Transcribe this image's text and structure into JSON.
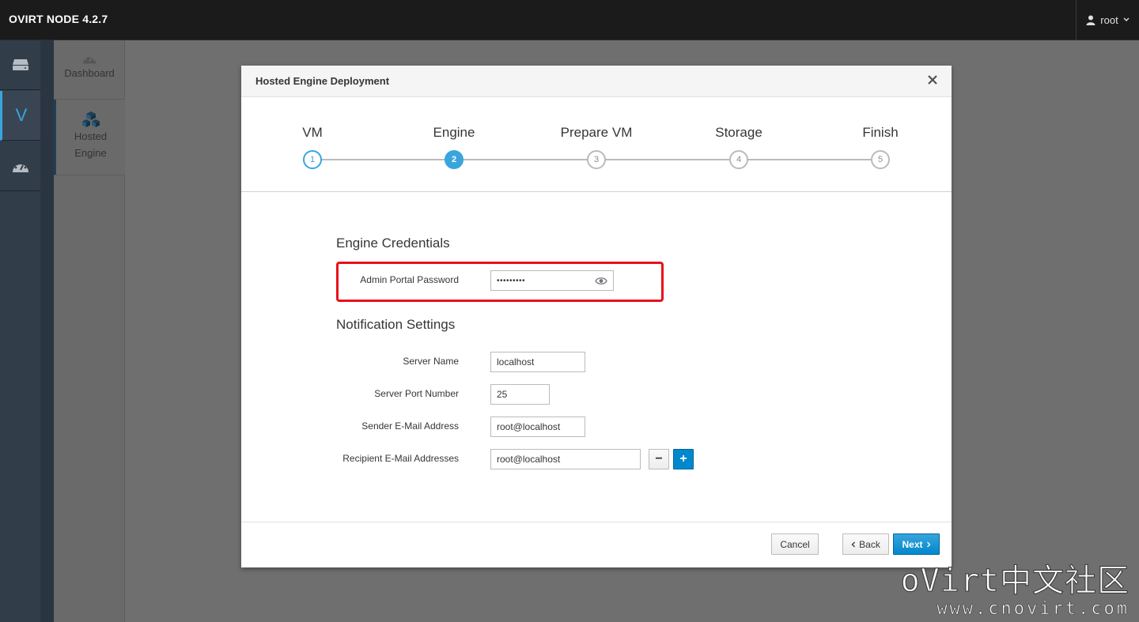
{
  "topbar": {
    "brand": "OVIRT NODE 4.2.7",
    "user": "root"
  },
  "rail": {
    "active_letter": "V"
  },
  "subnav": {
    "dashboard": "Dashboard",
    "hosted_engine_line1": "Hosted",
    "hosted_engine_line2": "Engine"
  },
  "modal": {
    "title": "Hosted Engine Deployment",
    "steps": [
      {
        "label": "VM",
        "number": "1",
        "state": "done"
      },
      {
        "label": "Engine",
        "number": "2",
        "state": "current"
      },
      {
        "label": "Prepare VM",
        "number": "3",
        "state": "pending"
      },
      {
        "label": "Storage",
        "number": "4",
        "state": "pending"
      },
      {
        "label": "Finish",
        "number": "5",
        "state": "pending"
      }
    ],
    "engine_credentials": {
      "heading": "Engine Credentials",
      "password_label": "Admin Portal Password",
      "password_value": "•••••••••"
    },
    "notification": {
      "heading": "Notification Settings",
      "server_name_label": "Server Name",
      "server_name_value": "localhost",
      "server_port_label": "Server Port Number",
      "server_port_value": "25",
      "sender_label": "Sender E-Mail Address",
      "sender_value": "root@localhost",
      "recipient_label": "Recipient E-Mail Addresses",
      "recipient_value": "root@localhost",
      "remove_symbol": "−",
      "add_symbol": "+"
    },
    "footer": {
      "cancel": "Cancel",
      "back": "Back",
      "next": "Next"
    }
  },
  "watermark": {
    "line1": "oVirt中文社区",
    "line2": "www.cnovirt.com"
  },
  "colors": {
    "accent": "#39a5dc",
    "primary": "#0088ce",
    "highlight": "#e8101b"
  }
}
